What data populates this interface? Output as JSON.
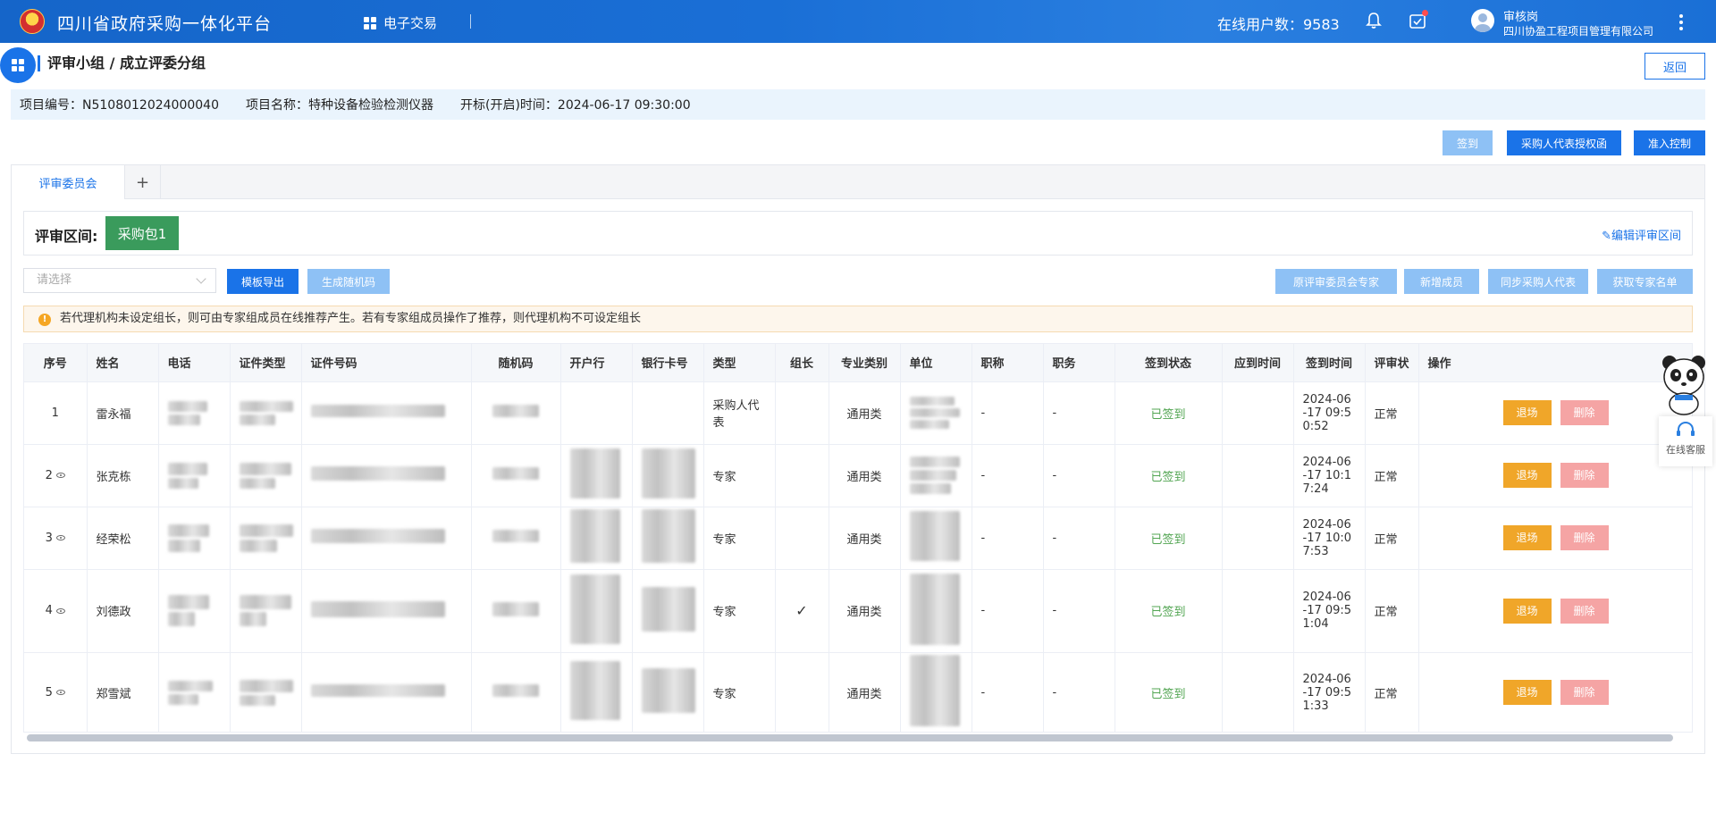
{
  "header": {
    "title": "四川省政府采购一体化平台",
    "nav_label": "电子交易",
    "online_users": "在线用户数：9583",
    "user_name": "审核岗",
    "user_org": "四川协盈工程项目管理有限公司"
  },
  "breadcrumb": "评审小组 / 成立评委分组",
  "back_label": "返回",
  "project": {
    "number": "项目编号：N5108012024000040",
    "name": "项目名称：特种设备检验检测仪器",
    "open_time": "开标(开启)时间：2024-06-17 09:30:00"
  },
  "top_actions": {
    "sign": "签到",
    "auth": "采购人代表授权函",
    "access": "准入控制"
  },
  "tabs": {
    "active": "评审委员会",
    "add": "+"
  },
  "section": {
    "label": "评审区间:",
    "package": "采购包1",
    "edit": "编辑评审区间"
  },
  "toolbar": {
    "select_placeholder": "请选择",
    "export": "模板导出",
    "gen_random": "生成随机码",
    "orig_experts": "原评审委员会专家",
    "add_member": "新增成员",
    "sync_rep": "同步采购人代表",
    "get_list": "获取专家名单"
  },
  "warning": "若代理机构未设定组长，则可由专家组成员在线推荐产生。若有专家组成员操作了推荐，则代理机构不可设定组长",
  "table": {
    "headers": [
      "序号",
      "姓名",
      "电话",
      "证件类型",
      "证件号码",
      "随机码",
      "开户行",
      "银行卡号",
      "类型",
      "组长",
      "专业类别",
      "单位",
      "职称",
      "职务",
      "签到状态",
      "应到时间",
      "签到时间",
      "评审状态",
      "操作"
    ],
    "rows": [
      {
        "no": "1",
        "name": "雷永福",
        "type": "采购人代表",
        "leader": "",
        "category": "通用类",
        "title": "-",
        "post": "-",
        "sign_status": "已签到",
        "sign_time": "2024-06-17 09:50:52",
        "review": "正常"
      },
      {
        "no": "2",
        "name": "张克栋",
        "type": "专家",
        "leader": "",
        "category": "通用类",
        "title": "-",
        "post": "-",
        "sign_status": "已签到",
        "sign_time": "2024-06-17 10:17:24",
        "review": "正常"
      },
      {
        "no": "3",
        "name": "经荣松",
        "type": "专家",
        "leader": "",
        "category": "通用类",
        "title": "-",
        "post": "-",
        "sign_status": "已签到",
        "sign_time": "2024-06-17 10:07:53",
        "review": "正常"
      },
      {
        "no": "4",
        "name": "刘德政",
        "type": "专家",
        "leader": "✓",
        "category": "通用类",
        "title": "-",
        "post": "-",
        "sign_status": "已签到",
        "sign_time": "2024-06-17 09:51:04",
        "review": "正常"
      },
      {
        "no": "5",
        "name": "郑雪斌",
        "type": "专家",
        "leader": "",
        "category": "通用类",
        "title": "-",
        "post": "-",
        "sign_status": "已签到",
        "sign_time": "2024-06-17 09:51:33",
        "review": "正常"
      }
    ],
    "exit_label": "退场",
    "delete_label": "删除"
  },
  "sign_time_lines": [
    [
      "2024-06",
      "-17 09:5",
      "0:52"
    ],
    [
      "2024-06",
      "-17 10:1",
      "7:24"
    ],
    [
      "2024-06",
      "-17 10:0",
      "7:53"
    ],
    [
      "2024-06",
      "-17 09:5",
      "1:04"
    ],
    [
      "2024-06",
      "-17 09:5",
      "1:33"
    ]
  ],
  "type_lines_row1": [
    "采购人代",
    "表"
  ],
  "review_header_visible": "评审状",
  "customer_service": "在线客服",
  "colors": {
    "header_blue": "#1a6fd6",
    "primary": "#1a73e8",
    "package_green": "#3a9b5c",
    "signed_green": "#52a552",
    "exit_orange": "#f0a629",
    "delete_pink": "#f5a4a4"
  }
}
